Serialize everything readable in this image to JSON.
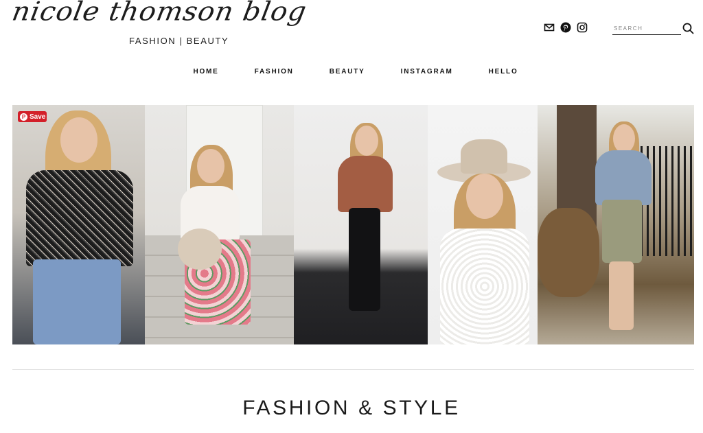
{
  "header": {
    "logo_script": "nicole thomson blog",
    "logo_subtitle": "FASHION | BEAUTY"
  },
  "social": {
    "icons": [
      "mail-icon",
      "pinterest-icon",
      "instagram-icon"
    ]
  },
  "search": {
    "placeholder": "SEARCH"
  },
  "nav": {
    "items": [
      {
        "label": "HOME"
      },
      {
        "label": "FASHION"
      },
      {
        "label": "BEAUTY"
      },
      {
        "label": "INSTAGRAM"
      },
      {
        "label": "HELLO"
      }
    ]
  },
  "gallery": {
    "save_label": "Save",
    "save_color": "#d3202a"
  },
  "section": {
    "title": "FASHION & STYLE"
  }
}
